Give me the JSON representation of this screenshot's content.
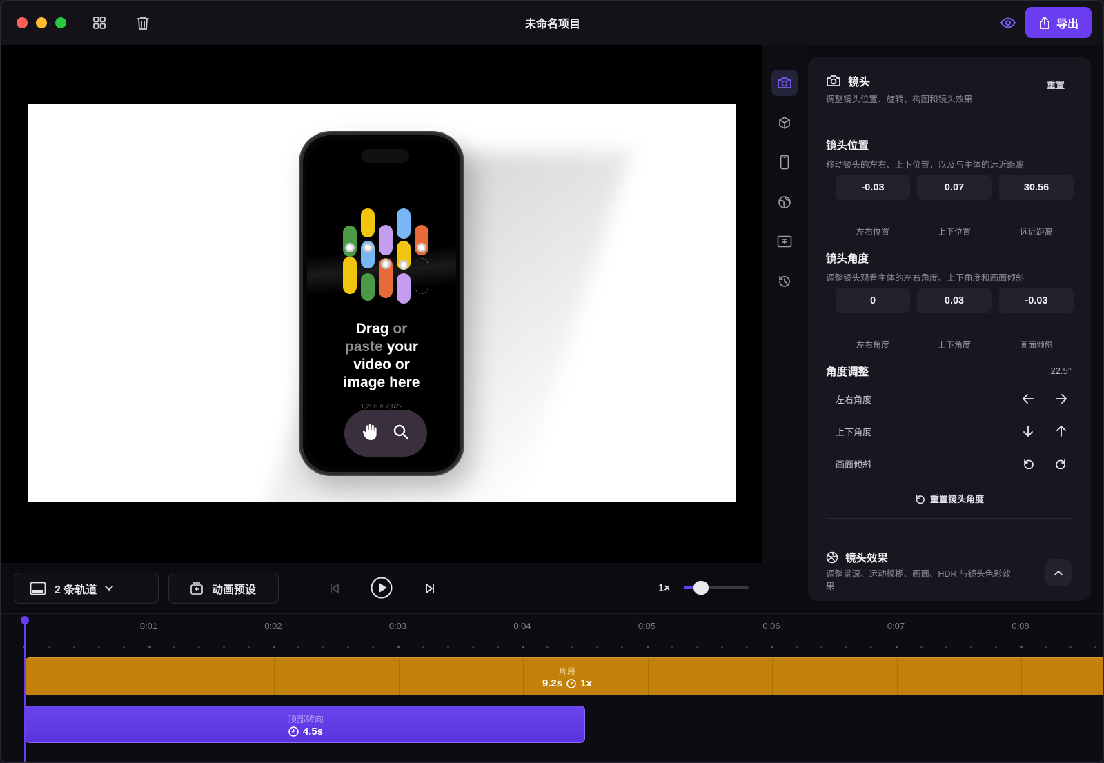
{
  "window": {
    "title": "未命名项目",
    "export_label": "导出"
  },
  "preview": {
    "drop_text": {
      "drag": "Drag",
      "or": "or",
      "paste": "paste",
      "your": "your",
      "line3": "video or",
      "line4": "image here"
    },
    "dimensions": "1,206 × 2,622"
  },
  "rail": {
    "icons": [
      "camera-icon",
      "cube-icon",
      "phone-icon",
      "globe-icon",
      "caption-icon",
      "history-icon"
    ],
    "active": "camera-icon"
  },
  "panel": {
    "title": "镜头",
    "description": "调整镜头位置、旋转、构图和镜头效果",
    "reset_label": "重置",
    "position": {
      "title": "镜头位置",
      "description": "移动镜头的左右、上下位置，以及与主体的远近距离",
      "fields": [
        {
          "value": "-0.03",
          "label": "左右位置"
        },
        {
          "value": "0.07",
          "label": "上下位置"
        },
        {
          "value": "30.56",
          "label": "远近距离"
        }
      ]
    },
    "angle": {
      "title": "镜头角度",
      "description": "调整镜头观看主体的左右角度、上下角度和画面倾斜",
      "fields": [
        {
          "value": "0",
          "label": "左右角度"
        },
        {
          "value": "0.03",
          "label": "上下角度"
        },
        {
          "value": "-0.03",
          "label": "画面倾斜"
        }
      ]
    },
    "adjust": {
      "title": "角度调整",
      "step": "22.5°",
      "rows": [
        "左右角度",
        "上下角度",
        "画面倾斜"
      ],
      "reset_label": "重置镜头角度"
    },
    "effects": {
      "title": "镜头效果",
      "description": "调整景深、运动模糊、画面、HDR 与镜头色彩效果"
    }
  },
  "transport": {
    "tracks_label": "2 条轨道",
    "presets_label": "动画预设",
    "speed_label": "1×",
    "speed_level": 0.27
  },
  "timeline": {
    "ticks": [
      "0:01",
      "0:02",
      "0:03",
      "0:04",
      "0:05",
      "0:06",
      "0:07",
      "0:08"
    ],
    "clip": {
      "name": "片段",
      "duration": "9.2s",
      "speed": "1x",
      "color": "#c2810a"
    },
    "animation": {
      "name": "顶部转向",
      "duration": "4.5s",
      "color": "#6a45ee"
    }
  },
  "colors": {
    "accent": "#6b3df0",
    "background": "#0b0b10"
  }
}
